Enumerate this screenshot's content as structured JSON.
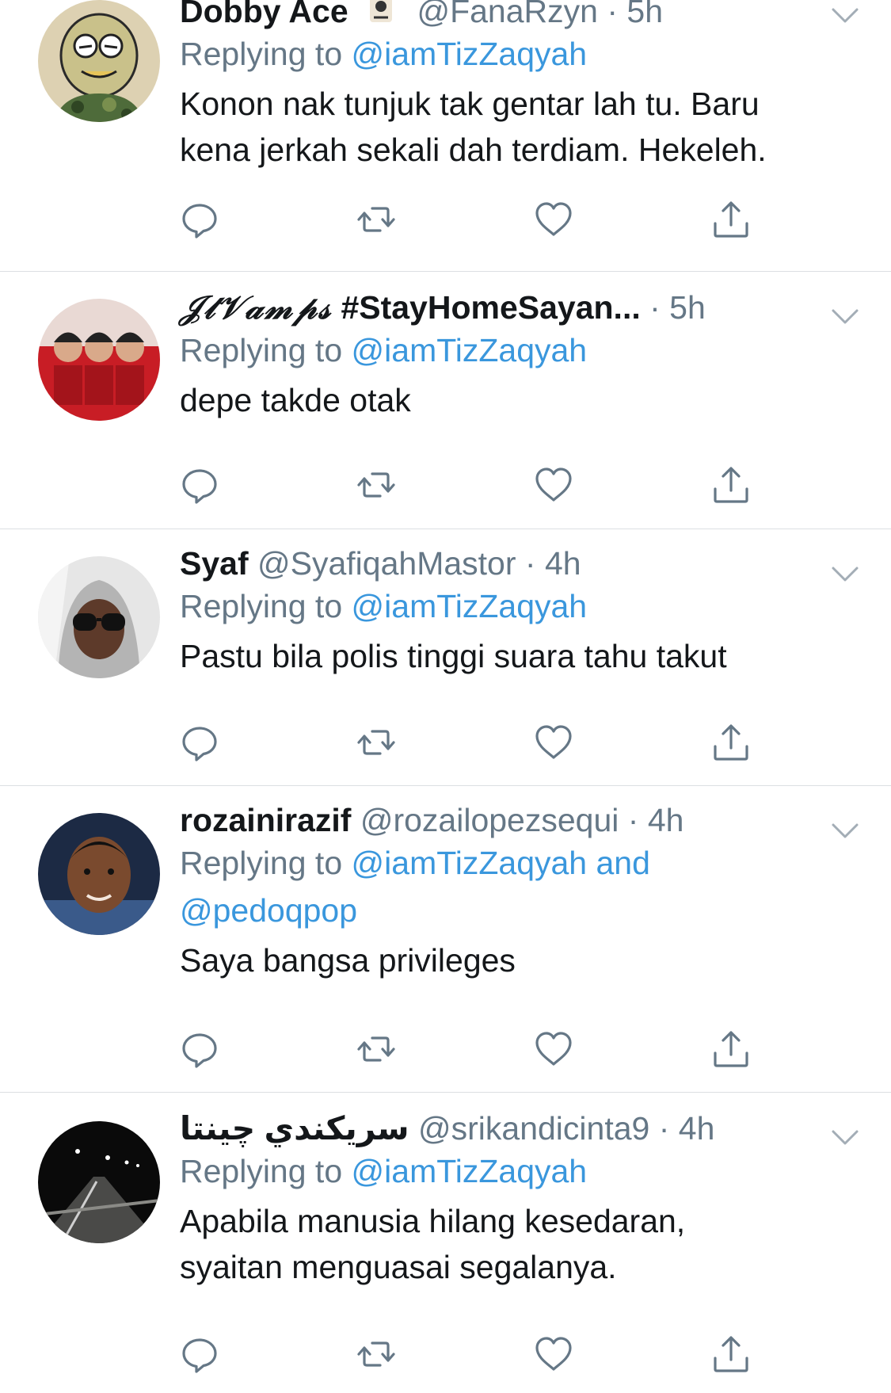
{
  "tweets": [
    {
      "name": "Dobby Ace",
      "handle": "@FanaRzyn",
      "time": "· 5h",
      "replying_prefix": "Replying to",
      "mention_line1": "@iamTizZaqyah",
      "mention_line2": "",
      "text_line1": "Konon nak tunjuk tak gentar lah tu. Baru",
      "text_line2": "kena jerkah sekali dah terdiam. Hekeleh."
    },
    {
      "name_fancy": "𝒥𝓉𝒱𝒶𝓂𝓅𝓈",
      "name": "#StayHomeSayan...",
      "handle": "",
      "time": "· 5h",
      "replying_prefix": "Replying to",
      "mention_line1": "@iamTizZaqyah",
      "mention_line2": "",
      "text_line1": "depe takde otak",
      "text_line2": ""
    },
    {
      "name": "Syaf",
      "handle": "@SyafiqahMastor",
      "time": "· 4h",
      "replying_prefix": "Replying to",
      "mention_line1": "@iamTizZaqyah",
      "mention_line2": "",
      "text_line1": "Pastu bila polis tinggi suara tahu takut",
      "text_line2": ""
    },
    {
      "name": "rozainirazif",
      "handle": "@rozailopezsequi",
      "time": "· 4h",
      "replying_prefix": "Replying to",
      "mention_line1": "@iamTizZaqyah and",
      "mention_line2": "@pedoqpop",
      "text_line1": "Saya bangsa privileges",
      "text_line2": ""
    },
    {
      "name": "سريكندي چينتا",
      "handle": "@srikandicinta9",
      "time": "· 4h",
      "replying_prefix": "Replying to",
      "mention_line1": "@iamTizZaqyah",
      "mention_line2": "",
      "text_line1": "Apabila manusia hilang kesedaran,",
      "text_line2": "syaitan menguasai segalanya."
    }
  ],
  "colors": {
    "mention": "#3a97dd",
    "secondary_text": "#657786",
    "icon": "#657786",
    "divider": "#dcdfe2"
  },
  "icons": {
    "reply": "reply-icon",
    "retweet": "retweet-icon",
    "like": "heart-icon",
    "share": "share-icon",
    "menu": "chevron-down-icon"
  }
}
